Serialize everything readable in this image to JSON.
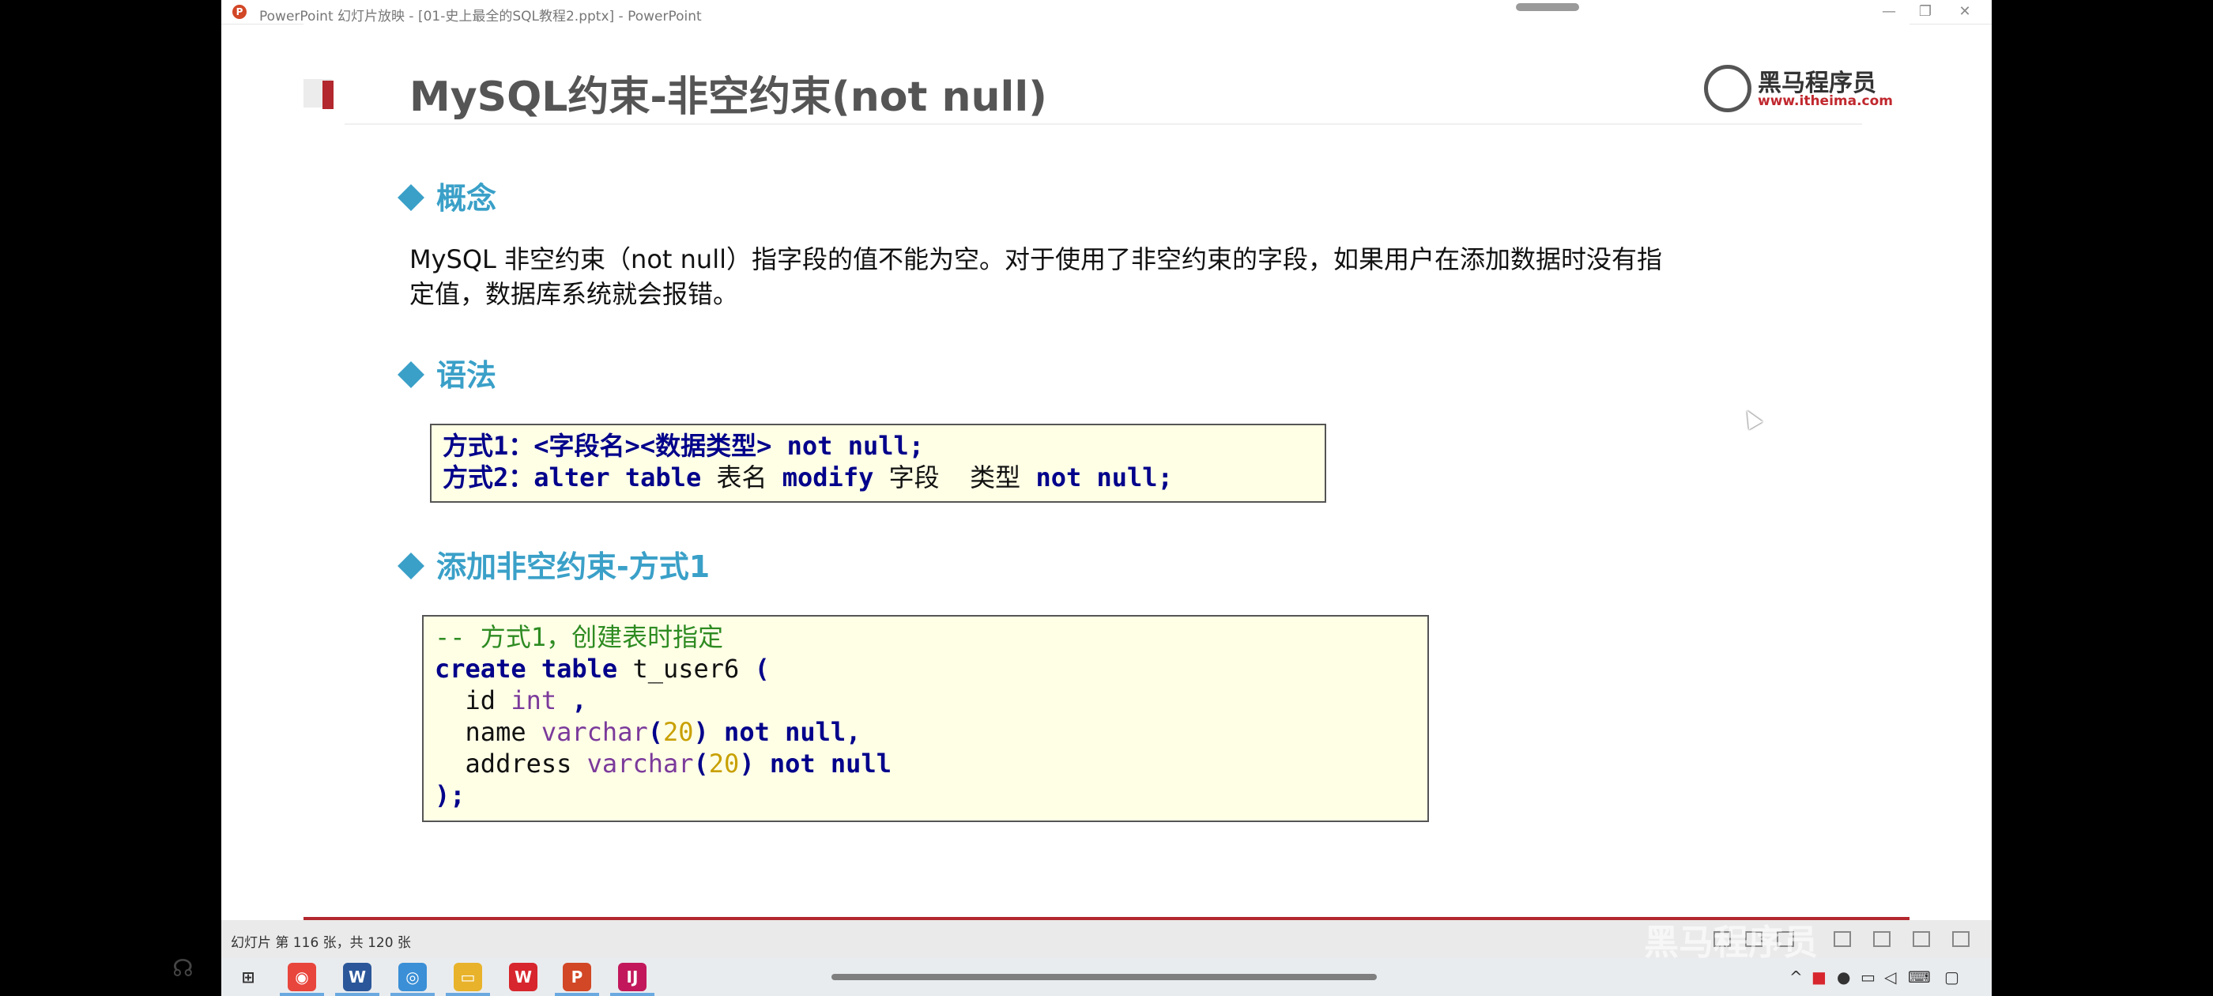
{
  "window": {
    "title": "PowerPoint 幻灯片放映 - [01-史上最全的SQL教程2.pptx] - PowerPoint",
    "app_icon": "P",
    "minimize": "—",
    "restore": "❐",
    "close": "✕"
  },
  "slide": {
    "title": "MySQL约束-非空约束(not null)",
    "logo": {
      "name": "黑马程序员",
      "url": "www.itheima.com"
    },
    "sections": [
      {
        "heading": "概念"
      },
      {
        "heading": "语法"
      },
      {
        "heading": "添加非空约束-方式1"
      }
    ],
    "concept_text": "MySQL 非空约束（not null）指字段的值不能为空。对于使用了非空约束的字段，如果用户在添加数据时没有指定值，数据库系统就会报错。",
    "syntax": {
      "line1": {
        "label": "方式1：",
        "part1": "<字段名><数据类型>",
        "kw": "not null;"
      },
      "line2": {
        "label": "方式2：",
        "kw1": "alter table",
        "t1": "表名",
        "kw2": "modify",
        "t2": "字段",
        "t3": "类型",
        "kw3": "not null;"
      }
    },
    "code": {
      "comment": "-- 方式1，创建表时指定",
      "create_kw": "create table",
      "table_name": "t_user6",
      "open_paren": "(",
      "col1": {
        "name": "id",
        "type": "int",
        "tail": ","
      },
      "col2": {
        "name": "name",
        "type": "varchar",
        "lp": "(",
        "len": "20",
        "rp": ")",
        "constraint": "not null,",
        "tail": ""
      },
      "col3": {
        "name": "address",
        "type": "varchar",
        "lp": "(",
        "len": "20",
        "rp": ")",
        "constraint": "not null"
      },
      "close": ");"
    }
  },
  "statusbar": {
    "slide_info": "幻灯片 第 116 张，共 120 张"
  },
  "taskbar": {
    "apps": [
      {
        "name": "Chrome",
        "glyph": "◉",
        "color": "#e8453c"
      },
      {
        "name": "Word",
        "glyph": "W",
        "color": "#2b579a"
      },
      {
        "name": "Browser",
        "glyph": "◎",
        "color": "#3a8fd6"
      },
      {
        "name": "Explorer",
        "glyph": "▭",
        "color": "#e8b32a"
      },
      {
        "name": "WPS",
        "glyph": "W",
        "color": "#d7262d"
      },
      {
        "name": "PowerPoint",
        "glyph": "P",
        "color": "#d24726"
      },
      {
        "name": "IntelliJ",
        "glyph": "IJ",
        "color": "#c2185b"
      }
    ],
    "start_glyph": "⊞"
  },
  "overlay": {
    "watermark": "黑马程序员"
  }
}
